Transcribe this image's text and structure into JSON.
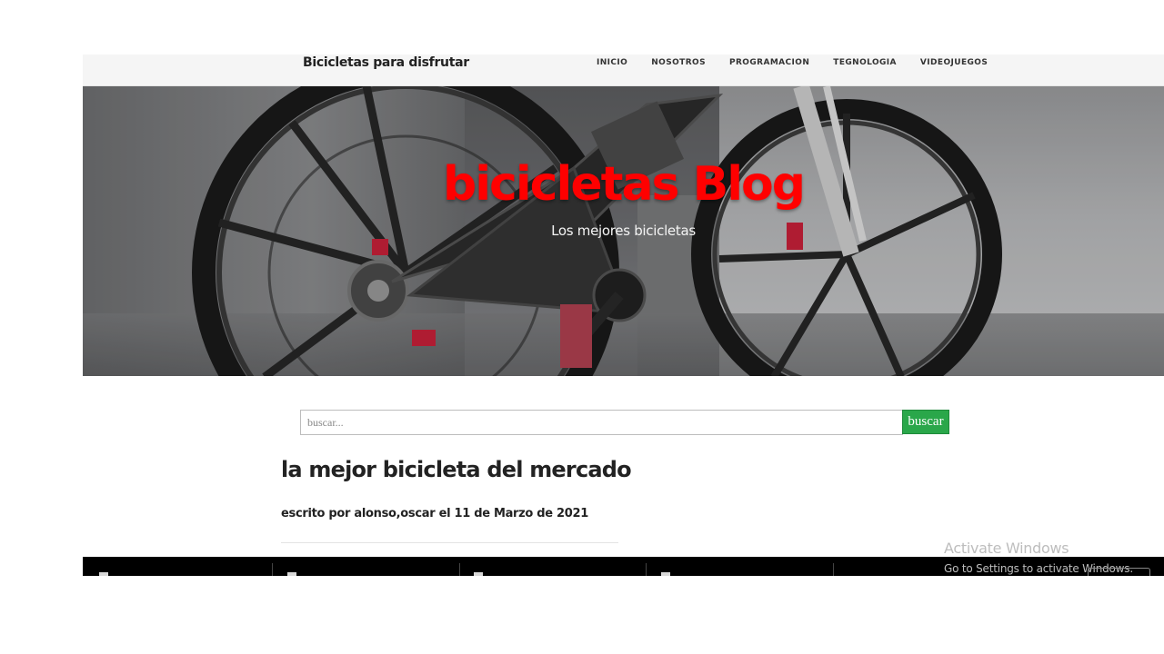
{
  "navbar": {
    "brand": "Bicicletas para disfrutar",
    "links": [
      "INICIO",
      "NOSOTROS",
      "PROGRAMACION",
      "TEGNOLOGIA",
      "VIDEOJUEGOS"
    ]
  },
  "hero": {
    "title": "bicicletas Blog",
    "subtitle": "Los mejores bicicletas",
    "title_color": "#ff0000"
  },
  "search": {
    "placeholder": "buscar...",
    "value": "",
    "button_label": "buscar",
    "button_color": "#2aa74a"
  },
  "post": {
    "title": "la mejor bicicleta del mercado",
    "meta": "escrito por alonso,oscar el 11 de Marzo de 2021"
  },
  "watermark": {
    "line1": "Activate Windows",
    "line2": "Go to Settings to activate Windows."
  }
}
